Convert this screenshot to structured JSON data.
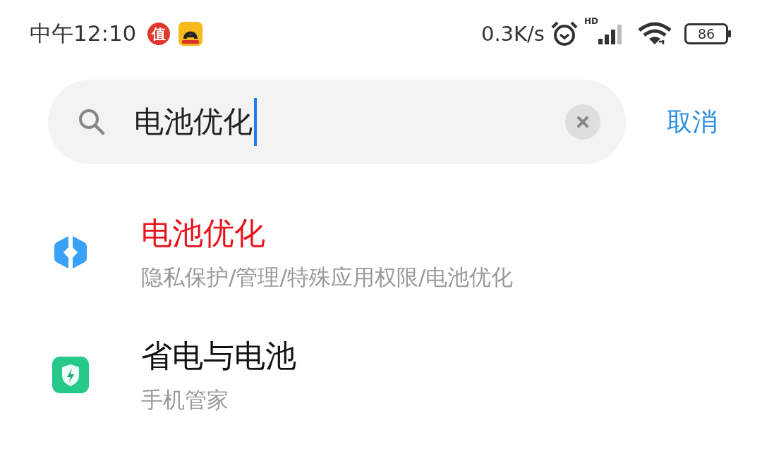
{
  "status_bar": {
    "time": "中午12:10",
    "notification_badge": "值",
    "network_speed": "0.3K/s",
    "signal_label": "HD",
    "battery": "86"
  },
  "search": {
    "value": "电池优化",
    "cancel": "取消"
  },
  "results": [
    {
      "title": "电池优化",
      "path": "隐私保护/管理/特殊应用权限/电池优化",
      "highlighted": true,
      "kind": "privacy"
    },
    {
      "title": "省电与电池",
      "path": "手机管家",
      "highlighted": false,
      "kind": "security"
    }
  ]
}
